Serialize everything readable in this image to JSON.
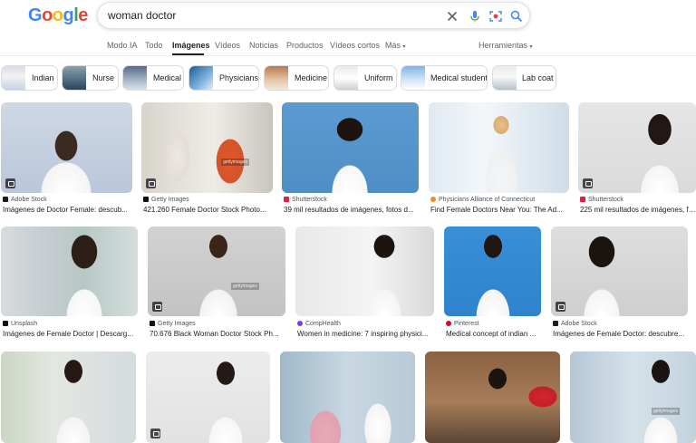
{
  "logo": {
    "letters": [
      "G",
      "o",
      "o",
      "g",
      "l",
      "e"
    ]
  },
  "search": {
    "query": "woman doctor"
  },
  "icons": {
    "clear": "close-icon",
    "voice": "mic-icon",
    "lens": "lens-icon",
    "search": "search-icon"
  },
  "tabs": [
    {
      "label": "Modo IA"
    },
    {
      "label": "Todo"
    },
    {
      "label": "Imágenes"
    },
    {
      "label": "Vídeos"
    },
    {
      "label": "Noticias"
    },
    {
      "label": "Productos"
    },
    {
      "label": "Vídeos cortos"
    },
    {
      "label": "Más"
    }
  ],
  "tools": {
    "label": "Herramientas"
  },
  "chips": [
    {
      "label": "Indian"
    },
    {
      "label": "Nurse"
    },
    {
      "label": "Medical"
    },
    {
      "label": "Physicians"
    },
    {
      "label": "Medicine"
    },
    {
      "label": "Uniform"
    },
    {
      "label": "Medical student"
    },
    {
      "label": "Lab coat"
    }
  ],
  "row1": [
    {
      "source": "Adobe Stock",
      "title": "Imágenes de Doctor Female: descub..."
    },
    {
      "source": "Getty Images",
      "title": "421.260 Female Doctor Stock Photo..."
    },
    {
      "source": "Shutterstock",
      "title": "39 mil resultados de imágenes, fotos d..."
    },
    {
      "source": "Physicians Alliance of Connecticut",
      "title": "Find Female Doctors Near You: The Ad..."
    },
    {
      "source": "Shutterstock",
      "title": "225 mil resultados de imágenes, foto..."
    }
  ],
  "row2": [
    {
      "source": "Unsplash",
      "title": "Imágenes de Female Doctor | Descarg..."
    },
    {
      "source": "Getty Images",
      "title": "70.676 Black Woman Doctor Stock Ph..."
    },
    {
      "source": "CompHealth",
      "title": "Women in medicine: 7 inspiring physici..."
    },
    {
      "source": "Pinterest",
      "title": "Medical concept of indian ..."
    },
    {
      "source": "Adobe Stock",
      "title": "Imágenes de Female Doctor: descubre..."
    }
  ],
  "watermarks": {
    "getty": "gettyimages"
  },
  "colors": {
    "blue": "#4285f4",
    "red": "#ea4335",
    "yellow": "#fbbc05",
    "green": "#34a853"
  }
}
